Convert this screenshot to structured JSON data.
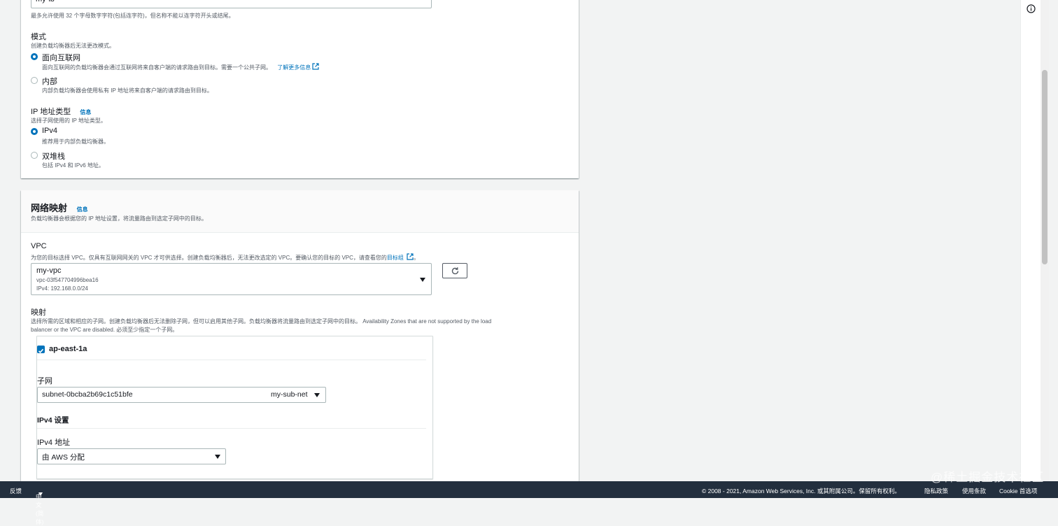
{
  "name_field": {
    "value": "my-lb",
    "hint": "最多允许使用 32 个字母数字字符(包括连字符)，但名称不能以连字符开头或结尾。"
  },
  "scheme": {
    "label": "模式",
    "desc": "创建负载均衡器后无法更改模式。",
    "options": [
      {
        "label": "面向互联网",
        "desc": "面向互联网的负载均衡器会通过互联网将来自客户端的请求路由到目标。需要一个公共子网。",
        "link": "了解更多信息",
        "selected": true
      },
      {
        "label": "内部",
        "desc": "内部负载均衡器会使用私有 IP 地址将来自客户端的请求路由到目标。",
        "selected": false
      }
    ]
  },
  "ip_type": {
    "label": "IP 地址类型",
    "info": "信息",
    "desc": "选择子网使用的 IP 地址类型。",
    "options": [
      {
        "label": "IPv4",
        "desc": "推荐用于内部负载均衡器。",
        "selected": true
      },
      {
        "label": "双堆栈",
        "desc": "包括 IPv4 和 IPv6 地址。",
        "selected": false
      }
    ]
  },
  "network": {
    "title": "网络映射",
    "info": "信息",
    "desc": "负载均衡器会根据您的 IP 地址设置，将流量路由到选定子网中的目标。",
    "vpc": {
      "label": "VPC",
      "desc": "为您的目标选择 VPC。仅具有互联网网关的 VPC 才可供选择。创建负载均衡器后，无法更改选定的 VPC。要确认您的目标的 VPC，请查看您的",
      "desc_link": "目标组",
      "desc_end": "。",
      "name": "my-vpc",
      "id": "vpc-03f547704996bea16",
      "cidr": "IPv4: 192.168.0.0/24"
    },
    "mapping": {
      "label": "映射",
      "desc_line1": "选择所需的区域和相应的子网。创建负载均衡器后无法删除子网，但可以启用其他子网。负载均衡器将流量路由到选定子网中的目标。 Availability Zones that are not supported by the load",
      "desc_line2": "balancer or the VPC are disabled. 必须至少指定一个子网。",
      "zone": "ap-east-1a",
      "subnet_label": "子网",
      "subnet_id": "subnet-0bcba2b69c1c51bfe",
      "subnet_name": "my-sub-net",
      "ipv4_settings": "IPv4 设置",
      "ipv4_address_label": "IPv4 地址",
      "ipv4_address_value": "由 AWS 分配"
    }
  },
  "footer": {
    "feedback": "反馈",
    "language": "中文(简体)",
    "copyright": "© 2008 - 2021, Amazon Web Services, Inc. 或其附属公司。保留所有权利。",
    "privacy": "隐私政策",
    "terms": "使用条款",
    "cookie": "Cookie 首选项"
  },
  "watermark": "@稀土掘金技术社区"
}
